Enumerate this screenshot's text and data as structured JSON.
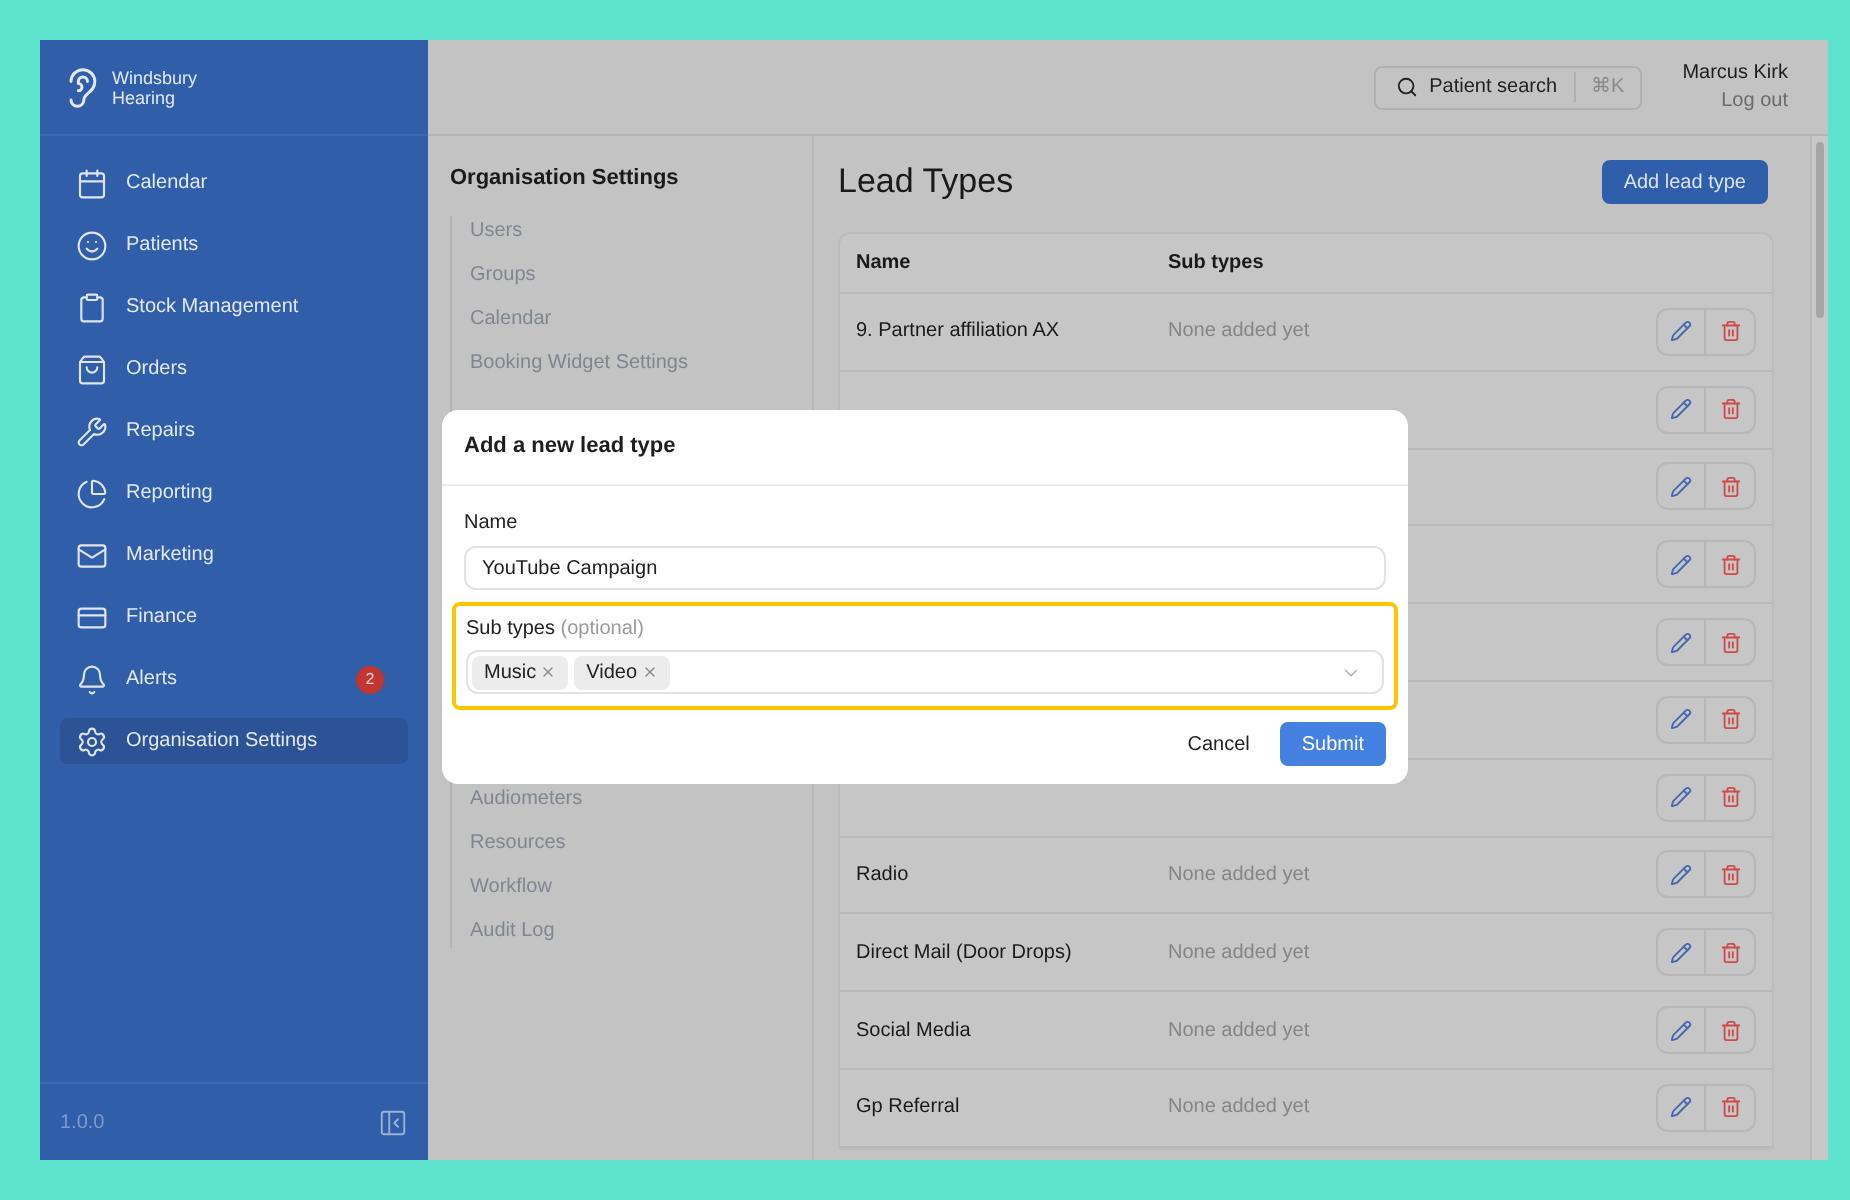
{
  "brand": {
    "line1": "Windsbury",
    "line2": "Hearing"
  },
  "nav": [
    {
      "label": "Calendar",
      "selected": false
    },
    {
      "label": "Patients",
      "selected": false
    },
    {
      "label": "Stock Management",
      "selected": false
    },
    {
      "label": "Orders",
      "selected": false
    },
    {
      "label": "Repairs",
      "selected": false
    },
    {
      "label": "Reporting",
      "selected": false
    },
    {
      "label": "Marketing",
      "selected": false
    },
    {
      "label": "Finance",
      "selected": false
    },
    {
      "label": "Alerts",
      "selected": false,
      "badge": "2"
    },
    {
      "label": "Organisation Settings",
      "selected": true
    }
  ],
  "version": "1.0.0",
  "header": {
    "search": "Patient search",
    "shortcut": "⌘K",
    "user": "Marcus Kirk",
    "logout": "Log out"
  },
  "settings_nav": {
    "title": "Organisation Settings",
    "items": [
      "Users",
      "Groups",
      "Calendar",
      "Booking Widget Settings"
    ],
    "more_items": [
      "Audiometers",
      "Resources",
      "Workflow",
      "Audit Log"
    ]
  },
  "page": {
    "title": "Lead Types",
    "add_button": "Add lead type",
    "table": {
      "columns": [
        "Name",
        "Sub types"
      ],
      "rows": [
        {
          "kind": "entry",
          "name": "9. Partner affiliation AX",
          "sub_types": "None added yet"
        },
        {
          "kind": "covered"
        },
        {
          "kind": "covered"
        },
        {
          "kind": "covered"
        },
        {
          "kind": "covered"
        },
        {
          "kind": "covered"
        },
        {
          "kind": "covered"
        },
        {
          "kind": "entry",
          "name": "Radio",
          "sub_types": "None added yet"
        },
        {
          "kind": "entry",
          "name": "Direct Mail (Door Drops)",
          "sub_types": "None added yet"
        },
        {
          "kind": "entry",
          "name": "Social Media",
          "sub_types": "None added yet"
        },
        {
          "kind": "entry",
          "name": "Gp Referral",
          "sub_types": "None added yet"
        }
      ]
    }
  },
  "modal": {
    "title": "Add a new lead type",
    "name": {
      "label": "Name",
      "value": "YouTube Campaign"
    },
    "sub_types": {
      "label": "Sub types",
      "hint": "(optional)",
      "highlighted": true,
      "tags": [
        "Music",
        "Video"
      ]
    },
    "cancel": "Cancel",
    "submit": "Submit"
  }
}
